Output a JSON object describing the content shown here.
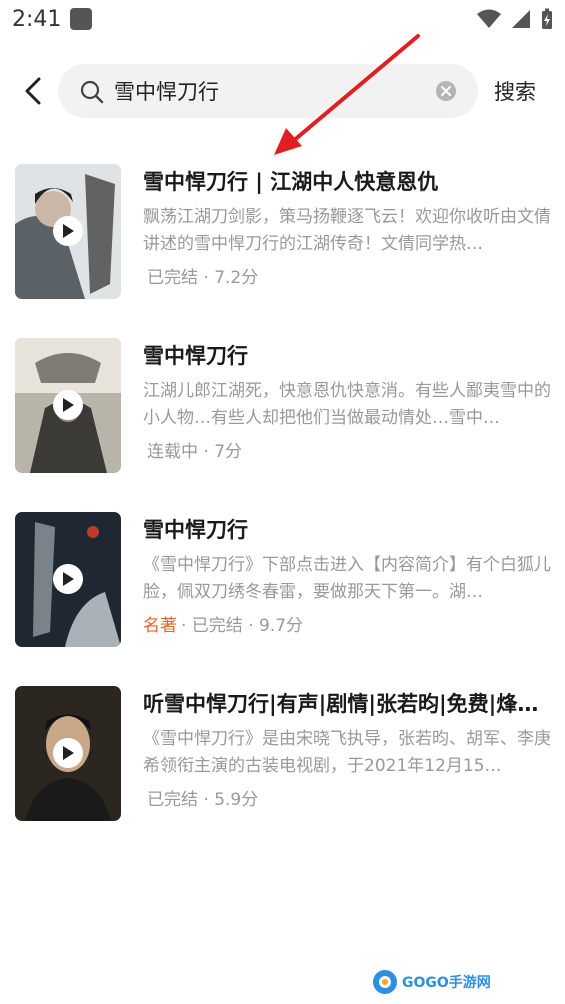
{
  "status_bar": {
    "time": "2:41"
  },
  "search": {
    "query": "雪中悍刀行",
    "button_label": "搜索"
  },
  "results": [
    {
      "title": "雪中悍刀行 | 江湖中人快意恩仇",
      "description": "飘荡江湖刀剑影，策马扬鞭逐飞云！欢迎你收听由文倩讲述的雪中悍刀行的江湖传奇！文倩同学热…",
      "tag": "",
      "meta": "已完结 · 7.2分",
      "cover_color": "#6b7378"
    },
    {
      "title": "雪中悍刀行",
      "description": "江湖儿郎江湖死，快意恩仇快意消。有些人鄙夷雪中的小人物…有些人却把他们当做最动情处…雪中…",
      "tag": "",
      "meta": "连载中 · 7分",
      "cover_color": "#7a7468"
    },
    {
      "title": "雪中悍刀行",
      "description": "《雪中悍刀行》下部点击进入【内容简介】有个白狐儿脸，佩双刀绣冬春雷，要做那天下第一。湖…",
      "tag": "名著",
      "meta": "· 已完结 · 9.7分",
      "cover_color": "#2a3340"
    },
    {
      "title": "听雪中悍刀行|有声|剧情|张若昀|免费|烽…",
      "description": "《雪中悍刀行》是由宋晓飞执导，张若昀、胡军、李庚希领衔主演的古装电视剧，于2021年12月15…",
      "tag": "",
      "meta": "已完结 · 5.9分",
      "cover_color": "#2b2620"
    }
  ],
  "watermark": {
    "text": "GOGO手游网"
  },
  "colors": {
    "accent_tag": "#e0662a",
    "annotation_arrow": "#e02020"
  }
}
